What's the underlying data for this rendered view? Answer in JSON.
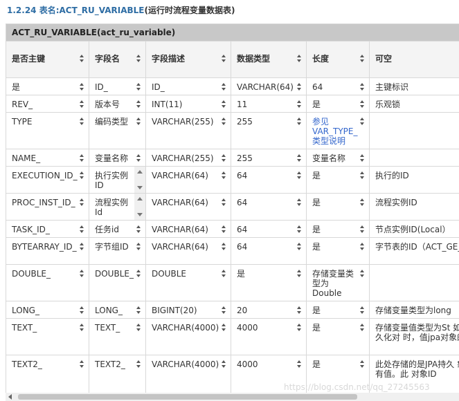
{
  "section": {
    "number": "1.2.24",
    "title": "表名:ACT_RU_VARIABLE",
    "suffix": "(运行时流程变量数据表)"
  },
  "table": {
    "caption": "ACT_RU_VARIABLE(act_ru_variable)",
    "columns": [
      "是否主键",
      "字段名",
      "字段描述",
      "数据类型",
      "长度",
      "可空"
    ],
    "rows": [
      [
        "是",
        "ID_",
        "ID_",
        "VARCHAR(64)",
        "64",
        "主键标识"
      ],
      [
        "REV_",
        "版本号",
        "INT(11)",
        "11",
        "是",
        "乐观锁"
      ],
      [
        "TYPE",
        "编码类型",
        "VARCHAR(255)",
        "255",
        "参见VAR_TYPE_类型说明",
        ""
      ],
      [
        "NAME_",
        "变量名称",
        "VARCHAR(255)",
        "255",
        "变量名称",
        ""
      ],
      [
        "EXECUTION_ID_",
        "执行实例ID",
        "VARCHAR(64)",
        "64",
        "是",
        "执行的ID"
      ],
      [
        "PROC_INST_ID_",
        "流程实例Id",
        "VARCHAR(64)",
        "64",
        "是",
        "流程实例ID"
      ],
      [
        "TASK_ID_",
        "任务id",
        "VARCHAR(64)",
        "64",
        "是",
        "节点实例ID(Local）"
      ],
      [
        "BYTEARRAY_ID_",
        "字节组ID",
        "VARCHAR(64)",
        "64",
        "是",
        "字节表的ID（ACT_GE_BYTEARR"
      ],
      [
        "DOUBLE_",
        "DOUBLE_",
        "DOUBLE",
        "是",
        "存储变量类型为Double",
        ""
      ],
      [
        "LONG_",
        "LONG_",
        "BIGINT(20)",
        "20",
        "是",
        "存储变量类型为long"
      ],
      [
        "TEXT_",
        "TEXT_",
        "VARCHAR(4000)",
        "4000",
        "是",
        "存储变量值类型为St 如此处存储持久化对 时，值jpa对象的clas"
      ],
      [
        "TEXT2_",
        "TEXT2_",
        "VARCHAR(4000)",
        "4000",
        "是",
        "此处存储的是JPA持久 象时，才会有值。此 对象ID"
      ]
    ]
  },
  "watermark": "https://blog.csdn.net/qq_27245563"
}
